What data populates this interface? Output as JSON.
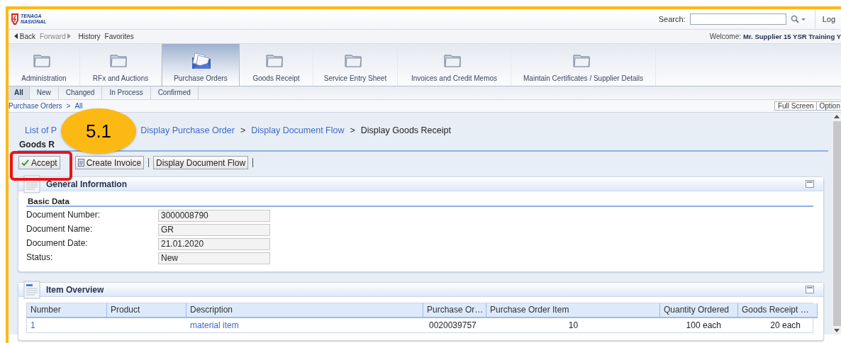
{
  "header": {
    "logo": "TENAGA NASIONAL",
    "search_label": "Search:",
    "logoff": "Log"
  },
  "nav": {
    "back": "Back",
    "forward": {
      "label": "Forward",
      "disabled": true
    },
    "history": "History",
    "favorites": "Favorites",
    "welcome_label": "Welcome:",
    "user": "Mr. Supplier 15 YSR Training Y"
  },
  "tabs": [
    {
      "label": "Administration",
      "selected": false
    },
    {
      "label": "RFx and Auctions",
      "selected": false
    },
    {
      "label": "Purchase Orders",
      "selected": true
    },
    {
      "label": "Goods Receipt",
      "selected": false
    },
    {
      "label": "Service Entry Sheet",
      "selected": false
    },
    {
      "label": "Invoices and Credit Memos",
      "selected": false
    },
    {
      "label": "Maintain Certificates / Supplier Details",
      "selected": false
    }
  ],
  "subtabs": [
    {
      "label": "All",
      "selected": true
    },
    {
      "label": "New",
      "selected": false
    },
    {
      "label": "Changed",
      "selected": false
    },
    {
      "label": "In Process",
      "selected": false
    },
    {
      "label": "Confirmed",
      "selected": false
    }
  ],
  "path": {
    "items": [
      "Purchase Orders",
      "All"
    ],
    "separator": ">",
    "buttons": [
      "Full Screen",
      "Option"
    ]
  },
  "breadcrumb": [
    {
      "text": "List of P",
      "link": true
    },
    {
      "text": "Display Purchase Order",
      "link": true
    },
    {
      "text": "Display Document Flow",
      "link": true,
      "sep": ">"
    },
    {
      "text": "Display Goods Receipt",
      "link": false,
      "sep": ">"
    }
  ],
  "page_title": "Goods R",
  "toolbar": [
    {
      "label": "Accept",
      "kind": "accept"
    },
    {
      "label": "Create Invoice",
      "kind": "invoice"
    },
    {
      "label": "Display Document Flow",
      "kind": "plain"
    }
  ],
  "general": {
    "title": "General Information",
    "section": "Basic Data",
    "fields": [
      {
        "label": "Document Number:",
        "value": "3000008790"
      },
      {
        "label": "Document Name:",
        "value": "GR"
      },
      {
        "label": "Document Date:",
        "value": "21.01.2020"
      },
      {
        "label": "Status:",
        "value": "New"
      }
    ]
  },
  "items": {
    "title": "Item Overview",
    "columns": [
      "Number",
      "Product",
      "Description",
      "Purchase Or…",
      "Purchase Order Item",
      "Quantity Ordered",
      "Goods Receipt …"
    ],
    "rows": [
      [
        {
          "text": "1",
          "link": true
        },
        null,
        {
          "text": "material item",
          "link": true
        },
        {
          "text": "0020039757",
          "link": false
        },
        {
          "text": "10",
          "link": false
        },
        {
          "text": "100 each",
          "link": false
        },
        {
          "text": "20 each",
          "link": false
        }
      ]
    ]
  },
  "callout": {
    "label": "5.1"
  }
}
